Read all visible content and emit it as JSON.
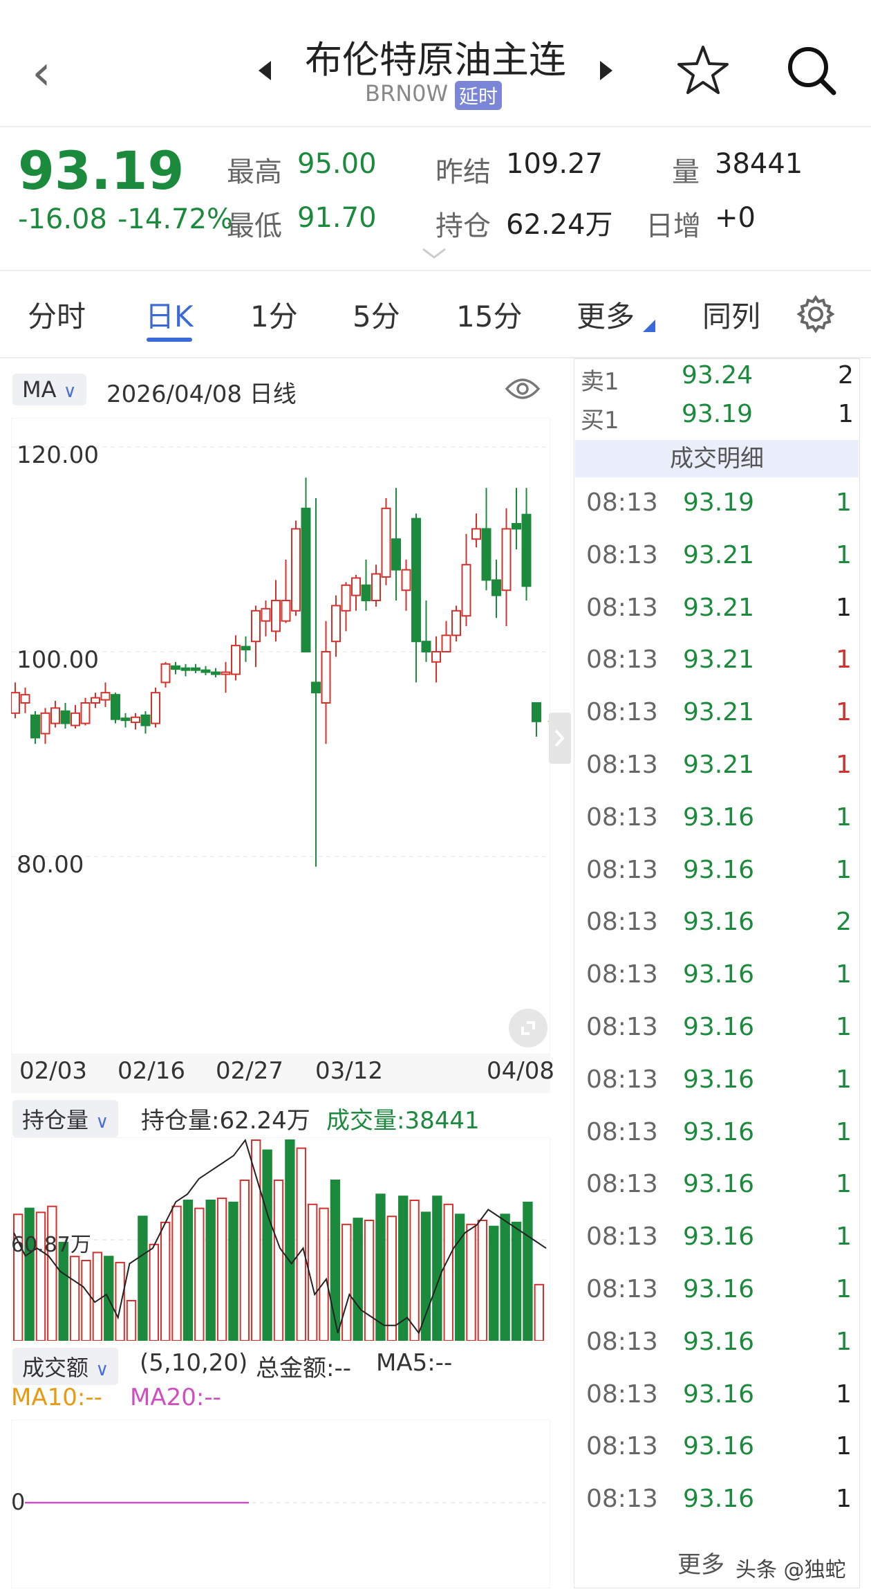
{
  "header": {
    "title": "布伦特原油主连",
    "code": "BRN0W",
    "badge": "延时"
  },
  "quote": {
    "price": "93.19",
    "change": "-16.08",
    "change_pct": "-14.72%",
    "high_label": "最高",
    "high": "95.00",
    "low_label": "最低",
    "low": "91.70",
    "prev_settle_label": "昨结",
    "prev_settle": "109.27",
    "position_label": "持仓",
    "position": "62.24万",
    "volume_label": "量",
    "volume": "38441",
    "daily_inc_label": "日增",
    "daily_inc": "+0"
  },
  "tabs": [
    "分时",
    "日K",
    "1分",
    "5分",
    "15分",
    "更多",
    "同列"
  ],
  "active_tab": "日K",
  "chart": {
    "indicator": "MA",
    "date_label": "2026/04/08 日线",
    "y_labels": [
      "120.00",
      "100.00",
      "80.00"
    ],
    "x_labels": [
      "02/03",
      "02/16",
      "02/27",
      "03/12",
      "04/08"
    ],
    "oi_selector": "持仓量",
    "oi_text": "持仓量:62.24万",
    "vol_text": "成交量:38441",
    "oi_ref": "60.87万",
    "amt_selector": "成交额",
    "amt_params": "(5,10,20)",
    "amt_total": "总金额:--",
    "ma5": "MA5:--",
    "ma10": "MA10:--",
    "ma20": "MA20:--",
    "amt_zero": "0"
  },
  "chart_data": {
    "type": "candlestick",
    "x_range": [
      "02/03",
      "04/08"
    ],
    "ylim": [
      75,
      122
    ],
    "candles": [
      {
        "o": 94,
        "c": 96,
        "h": 97,
        "l": 93.5,
        "up": true
      },
      {
        "o": 95,
        "c": 95.8,
        "h": 96.5,
        "l": 94,
        "up": true
      },
      {
        "o": 93.8,
        "c": 91.6,
        "h": 94.2,
        "l": 91,
        "up": false
      },
      {
        "o": 92,
        "c": 94,
        "h": 94.5,
        "l": 91,
        "up": true
      },
      {
        "o": 93,
        "c": 94.5,
        "h": 95.2,
        "l": 92.6,
        "up": true
      },
      {
        "o": 94.2,
        "c": 93,
        "h": 95,
        "l": 92.5,
        "up": false
      },
      {
        "o": 92.8,
        "c": 94,
        "h": 94.8,
        "l": 92.5,
        "up": true
      },
      {
        "o": 93,
        "c": 95,
        "h": 95.5,
        "l": 92.8,
        "up": true
      },
      {
        "o": 95,
        "c": 95.5,
        "h": 96,
        "l": 94.5,
        "up": true
      },
      {
        "o": 95.3,
        "c": 96,
        "h": 97,
        "l": 94.6,
        "up": true
      },
      {
        "o": 95.8,
        "c": 93.4,
        "h": 96,
        "l": 93,
        "up": false
      },
      {
        "o": 93.5,
        "c": 93.3,
        "h": 94,
        "l": 92.6,
        "up": false
      },
      {
        "o": 93.1,
        "c": 93.6,
        "h": 94,
        "l": 92.4,
        "up": true
      },
      {
        "o": 93.8,
        "c": 92.8,
        "h": 94.2,
        "l": 92,
        "up": false
      },
      {
        "o": 93,
        "c": 96,
        "h": 96.5,
        "l": 92.6,
        "up": true
      },
      {
        "o": 97,
        "c": 98.8,
        "h": 99,
        "l": 96.5,
        "up": true
      },
      {
        "o": 98.6,
        "c": 98.3,
        "h": 99,
        "l": 97.8,
        "up": false
      },
      {
        "o": 98.4,
        "c": 98.2,
        "h": 98.8,
        "l": 97.6,
        "up": false
      },
      {
        "o": 98.4,
        "c": 98.2,
        "h": 98.8,
        "l": 97.9,
        "up": false
      },
      {
        "o": 98.2,
        "c": 98,
        "h": 98.6,
        "l": 97.7,
        "up": false
      },
      {
        "o": 98,
        "c": 97.8,
        "h": 98.4,
        "l": 97.5,
        "up": false
      },
      {
        "o": 97.8,
        "c": 98,
        "h": 99,
        "l": 96,
        "up": true
      },
      {
        "o": 97.8,
        "c": 100.6,
        "h": 101.6,
        "l": 97.2,
        "up": true
      },
      {
        "o": 100.5,
        "c": 100.2,
        "h": 101.5,
        "l": 99,
        "up": false
      },
      {
        "o": 101,
        "c": 104,
        "h": 104.5,
        "l": 98.5,
        "up": true
      },
      {
        "o": 103,
        "c": 104.2,
        "h": 105,
        "l": 101.5,
        "up": true
      },
      {
        "o": 102,
        "c": 105,
        "h": 107,
        "l": 101,
        "up": true
      },
      {
        "o": 103,
        "c": 105,
        "h": 109,
        "l": 102.8,
        "up": true
      },
      {
        "o": 104,
        "c": 112,
        "h": 112.8,
        "l": 103.5,
        "up": true
      },
      {
        "o": 114,
        "c": 100,
        "h": 117,
        "l": 102,
        "up": false
      },
      {
        "o": 96,
        "c": 97,
        "h": 115,
        "l": 79,
        "up": false
      },
      {
        "o": 95,
        "c": 100,
        "h": 103,
        "l": 91,
        "up": true
      },
      {
        "o": 101,
        "c": 104.5,
        "h": 105.5,
        "l": 99.5,
        "up": true
      },
      {
        "o": 104,
        "c": 106.5,
        "h": 106.8,
        "l": 102,
        "up": true
      },
      {
        "o": 105.5,
        "c": 107.2,
        "h": 107.5,
        "l": 104,
        "up": true
      },
      {
        "o": 106.5,
        "c": 105,
        "h": 109,
        "l": 104,
        "up": false
      },
      {
        "o": 105,
        "c": 107.6,
        "h": 108.5,
        "l": 104.4,
        "up": true
      },
      {
        "o": 107.3,
        "c": 114,
        "h": 115,
        "l": 106.5,
        "up": true
      },
      {
        "o": 111,
        "c": 108,
        "h": 116,
        "l": 105,
        "up": false
      },
      {
        "o": 108,
        "c": 106,
        "h": 109,
        "l": 104,
        "up": true
      },
      {
        "o": 113,
        "c": 101,
        "h": 113.5,
        "l": 97,
        "up": false
      },
      {
        "o": 101,
        "c": 100,
        "h": 105,
        "l": 99,
        "up": false
      },
      {
        "o": 99,
        "c": 100,
        "h": 101.5,
        "l": 97,
        "up": true
      },
      {
        "o": 100,
        "c": 101.6,
        "h": 103,
        "l": 100,
        "up": true
      },
      {
        "o": 101.6,
        "c": 104,
        "h": 104.5,
        "l": 101,
        "up": true
      },
      {
        "o": 103.5,
        "c": 108.5,
        "h": 111.5,
        "l": 102.5,
        "up": true
      },
      {
        "o": 112,
        "c": 111,
        "h": 113.5,
        "l": 110.2,
        "up": true
      },
      {
        "o": 112,
        "c": 107,
        "h": 116,
        "l": 106,
        "up": false
      },
      {
        "o": 107,
        "c": 105.5,
        "h": 109,
        "l": 103.3,
        "up": false
      },
      {
        "o": 106,
        "c": 112,
        "h": 114,
        "l": 102.5,
        "up": true
      },
      {
        "o": 112,
        "c": 112.5,
        "h": 116,
        "l": 110,
        "up": false
      },
      {
        "o": 113.4,
        "c": 106.4,
        "h": 116,
        "l": 105,
        "up": false
      },
      {
        "o": 95,
        "c": 93.19,
        "h": 95,
        "l": 91.7,
        "up": false
      }
    ],
    "open_interest": [
      62,
      59,
      60,
      59,
      57,
      56,
      55,
      53,
      54,
      51,
      58,
      59,
      60,
      63,
      66,
      67,
      69,
      70,
      71,
      72,
      74,
      69,
      64,
      60,
      58,
      60,
      54,
      56,
      49,
      54,
      52,
      51,
      50,
      50,
      51,
      49,
      53,
      57,
      60,
      62,
      63,
      65,
      64,
      63,
      62,
      61,
      60
    ],
    "volumes": [
      63,
      66,
      64,
      67,
      49,
      42,
      40,
      44,
      42,
      39,
      20,
      62,
      48,
      59,
      67,
      70,
      66,
      70,
      71,
      69,
      80,
      100,
      95,
      80,
      100,
      96,
      68,
      66,
      80,
      58,
      61,
      60,
      73,
      62,
      72,
      70,
      64,
      72,
      68,
      63,
      58,
      60,
      57,
      63,
      59,
      69,
      28
    ],
    "vol_up": [
      true,
      false,
      true,
      true,
      false,
      true,
      true,
      true,
      false,
      true,
      true,
      false,
      true,
      true,
      true,
      false,
      true,
      false,
      true,
      false,
      true,
      true,
      false,
      true,
      false,
      true,
      true,
      true,
      false,
      true,
      false,
      true,
      false,
      true,
      false,
      true,
      false,
      false,
      true,
      false,
      true,
      true,
      false,
      false,
      false,
      false,
      true
    ],
    "oi_ref": 60.87,
    "amount_total_zero": 0
  },
  "orderbook": {
    "ask_label": "卖1",
    "ask_price": "93.24",
    "ask_qty": "2",
    "bid_label": "买1",
    "bid_price": "93.19",
    "bid_qty": "1",
    "section": "成交明细",
    "ticks": [
      {
        "t": "08:13",
        "p": "93.19",
        "q": "1",
        "c": "green"
      },
      {
        "t": "08:13",
        "p": "93.21",
        "q": "1",
        "c": "green"
      },
      {
        "t": "08:13",
        "p": "93.21",
        "q": "1",
        "c": "dark"
      },
      {
        "t": "08:13",
        "p": "93.21",
        "q": "1",
        "c": "red"
      },
      {
        "t": "08:13",
        "p": "93.21",
        "q": "1",
        "c": "red"
      },
      {
        "t": "08:13",
        "p": "93.21",
        "q": "1",
        "c": "red"
      },
      {
        "t": "08:13",
        "p": "93.16",
        "q": "1",
        "c": "green"
      },
      {
        "t": "08:13",
        "p": "93.16",
        "q": "1",
        "c": "green"
      },
      {
        "t": "08:13",
        "p": "93.16",
        "q": "2",
        "c": "green"
      },
      {
        "t": "08:13",
        "p": "93.16",
        "q": "1",
        "c": "green"
      },
      {
        "t": "08:13",
        "p": "93.16",
        "q": "1",
        "c": "green"
      },
      {
        "t": "08:13",
        "p": "93.16",
        "q": "1",
        "c": "green"
      },
      {
        "t": "08:13",
        "p": "93.16",
        "q": "1",
        "c": "green"
      },
      {
        "t": "08:13",
        "p": "93.16",
        "q": "1",
        "c": "green"
      },
      {
        "t": "08:13",
        "p": "93.16",
        "q": "1",
        "c": "green"
      },
      {
        "t": "08:13",
        "p": "93.16",
        "q": "1",
        "c": "green"
      },
      {
        "t": "08:13",
        "p": "93.16",
        "q": "1",
        "c": "green"
      },
      {
        "t": "08:13",
        "p": "93.16",
        "q": "1",
        "c": "dark"
      },
      {
        "t": "08:13",
        "p": "93.16",
        "q": "1",
        "c": "dark"
      },
      {
        "t": "08:13",
        "p": "93.16",
        "q": "1",
        "c": "dark"
      }
    ],
    "more": "更多",
    "watermark": "头条 @独蛇"
  },
  "colors": {
    "up": "#d4312d",
    "down": "#1c8a3c",
    "accent": "#3a6ad8",
    "magenta": "#d04ec2",
    "orange": "#e89a10"
  }
}
